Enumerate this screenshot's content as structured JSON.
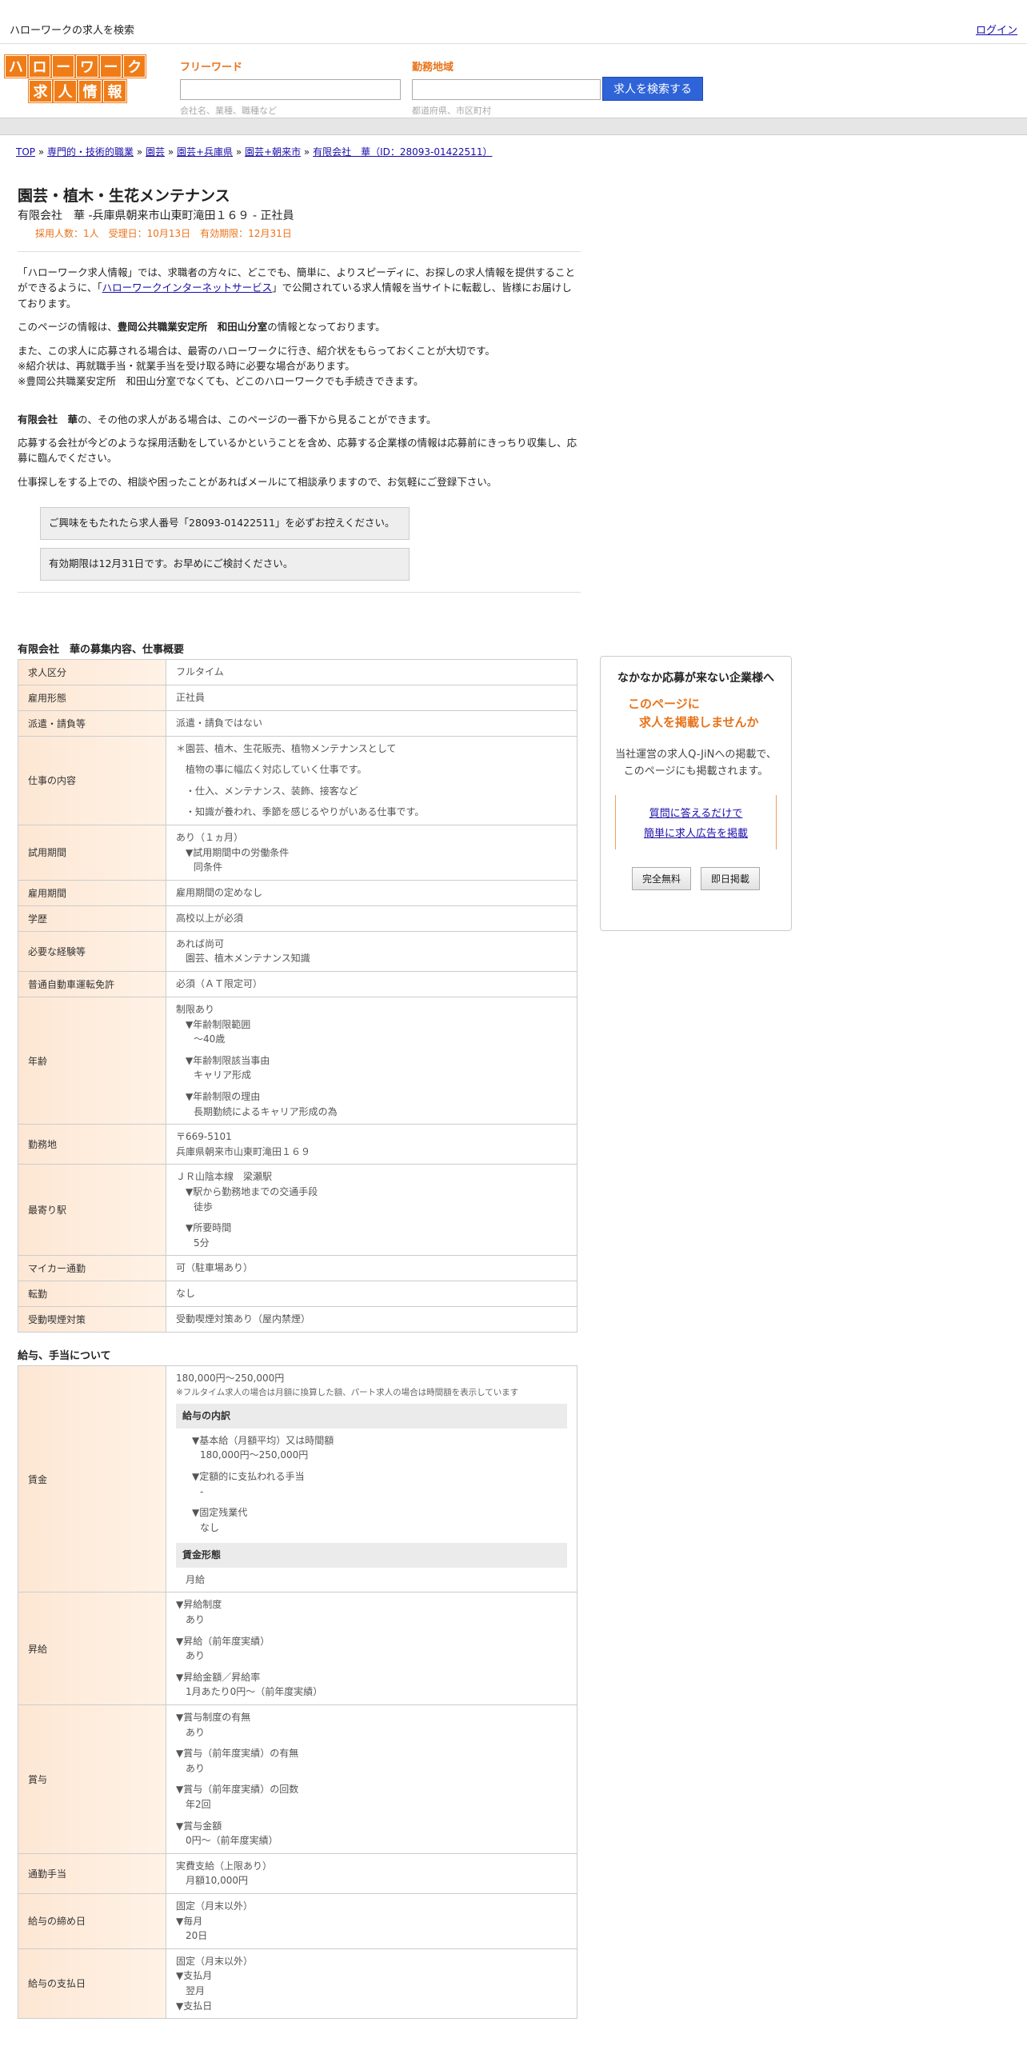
{
  "topbar": {
    "title": "ハローワークの求人を検索",
    "login": "ログイン"
  },
  "logo": {
    "row1": [
      "ハ",
      "ロ",
      "ー",
      "ワ",
      "ー",
      "ク"
    ],
    "row2": [
      "求",
      "人",
      "情",
      "報"
    ]
  },
  "search": {
    "free_label": "フリーワード",
    "free_placeholder": "",
    "free_hint": "会社名、業種、職種など",
    "area_label": "勤務地域",
    "area_placeholder": "",
    "area_hint": "都道府県、市区町村",
    "button": "求人を検索する"
  },
  "breadcrumb": {
    "items": [
      "TOP",
      "専門的・技術的職業",
      "園芸",
      "園芸+兵庫県",
      "園芸+朝来市",
      "有限会社　華（ID：28093-01422511）"
    ],
    "sep": " » "
  },
  "job": {
    "title": "園芸・植木・生花メンテナンス",
    "company_line": "有限会社　華 -兵庫県朝来市山東町滝田１６９ - 正社員",
    "meta": "採用人数：1人　受理日：10月13日　有効期限：12月31日"
  },
  "intro": {
    "p1a": "「ハローワーク求人情報」では、求職者の方々に、どこでも、簡単に、よりスピーディに、お探しの求人情報を提供することができるように、「",
    "p1link": "ハローワークインターネットサービス",
    "p1b": "」で公開されている求人情報を当サイトに転載し、皆様にお届けしております。",
    "p2a": "このページの情報は、",
    "p2b": "豊岡公共職業安定所　和田山分室",
    "p2c": "の情報となっております。",
    "p3a": "また、この求人に応募される場合は、最寄のハローワークに行き、紹介状をもらっておくことが大切です。",
    "p3b": "※紹介状は、再就職手当・就業手当を受け取る時に必要な場合があります。",
    "p3c": "※豊岡公共職業安定所　和田山分室でなくても、どこのハローワークでも手続きできます。",
    "p4a": "有限会社　華",
    "p4b": "の、その他の求人がある場合は、このページの一番下から見ることができます。",
    "p5": "応募する会社が今どのような採用活動をしているかということを含め、応募する企業様の情報は応募前にきっちり収集し、応募に臨んでください。",
    "p6": "仕事探しをする上での、相談や困ったことがあればメールにて相談承りますので、お気軽にご登録下さい。",
    "notice1": "ご興味をもたれたら求人番号「28093-01422511」を必ずお控えください。",
    "notice2": "有効期限は12月31日です。お早めにご検討ください。"
  },
  "spec": {
    "heading": "有限会社　華の募集内容、仕事概要",
    "r1h": "求人区分",
    "r1v": "フルタイム",
    "r2h": "雇用形態",
    "r2v": "正社員",
    "r3h": "派遣・請負等",
    "r3v": "派遣・請負ではない",
    "r4h": "仕事の内容",
    "r4v1": "＊園芸、植木、生花販売、植物メンテナンスとして",
    "r4v2": "植物の事に幅広く対応していく仕事です。",
    "r4v3": "・仕入、メンテナンス、装飾、接客など",
    "r4v4": "・知識が養われ、季節を感じるやりがいある仕事です。",
    "r5h": "試用期間",
    "r5v1": "あり（１ヵ月）",
    "r5v2": "▼試用期間中の労働条件",
    "r5v3": "同条件",
    "r6h": "雇用期間",
    "r6v": "雇用期間の定めなし",
    "r7h": "学歴",
    "r7v": "高校以上が必須",
    "r8h": "必要な経験等",
    "r8v1": "あれば尚可",
    "r8v2": "園芸、植木メンテナンス知識",
    "r9h": "普通自動車運転免許",
    "r9v": "必須（ＡＴ限定可）",
    "r10h": "年齢",
    "r10v1": "制限あり",
    "r10v2": "▼年齢制限範囲",
    "r10v3": "〜40歳",
    "r10v4": "▼年齢制限該当事由",
    "r10v5": "キャリア形成",
    "r10v6": "▼年齢制限の理由",
    "r10v7": "長期勤続によるキャリア形成の為",
    "r11h": "勤務地",
    "r11v1": "〒669-5101",
    "r11v2": "兵庫県朝来市山東町滝田１６９",
    "r12h": "最寄り駅",
    "r12v1": "ＪＲ山陰本線　梁瀬駅",
    "r12v2": "▼駅から勤務地までの交通手段",
    "r12v3": "徒歩",
    "r12v4": "▼所要時間",
    "r12v5": "5分",
    "r13h": "マイカー通勤",
    "r13v": "可（駐車場あり）",
    "r14h": "転勤",
    "r14v": "なし",
    "r15h": "受動喫煙対策",
    "r15v": "受動喫煙対策あり（屋内禁煙）"
  },
  "salary": {
    "heading": "給与、手当について",
    "s1h": "賃金",
    "s1v1": "180,000円〜250,000円",
    "s1note": "※フルタイム求人の場合は月額に換算した額、パート求人の場合は時間額を表示しています",
    "s1sub": "給与の内訳",
    "s1v2": "▼基本給（月額平均）又は時間額",
    "s1v3": "180,000円〜250,000円",
    "s1v4": "▼定額的に支払われる手当",
    "s1v5": "-",
    "s1v6": "▼固定残業代",
    "s1v7": "なし",
    "s1sub2": "賃金形態",
    "s1v8": "月給",
    "s2h": "昇給",
    "s2v1": "▼昇給制度",
    "s2v2": "あり",
    "s2v3": "▼昇給（前年度実績）",
    "s2v4": "あり",
    "s2v5": "▼昇給金額／昇給率",
    "s2v6": "1月あたり0円〜（前年度実績）",
    "s3h": "賞与",
    "s3v1": "▼賞与制度の有無",
    "s3v2": "あり",
    "s3v3": "▼賞与（前年度実績）の有無",
    "s3v4": "あり",
    "s3v5": "▼賞与（前年度実績）の回数",
    "s3v6": "年2回",
    "s3v7": "▼賞与金額",
    "s3v8": "0円〜（前年度実績）",
    "s4h": "通勤手当",
    "s4v1": "実費支給（上限あり）",
    "s4v2": "月額10,000円",
    "s5h": "給与の締め日",
    "s5v1": "固定（月末以外）",
    "s5v2": "▼毎月",
    "s5v3": "20日",
    "s6h": "給与の支払日",
    "s6v1": "固定（月末以外）",
    "s6v2": "▼支払月",
    "s6v3": "翌月",
    "s6v4": "▼支払日"
  },
  "ad": {
    "heading": "なかなか応募が来ない企業様へ",
    "orange1": "このページに",
    "orange2": "求人を掲載しませんか",
    "text1": "当社運営の求人Q-JiNへの掲載で、",
    "text2": "このページにも掲載されます。",
    "link1": "質問に答えるだけで",
    "link2": "簡単に求人広告を掲載",
    "btn1": "完全無料",
    "btn2": "即日掲載"
  }
}
